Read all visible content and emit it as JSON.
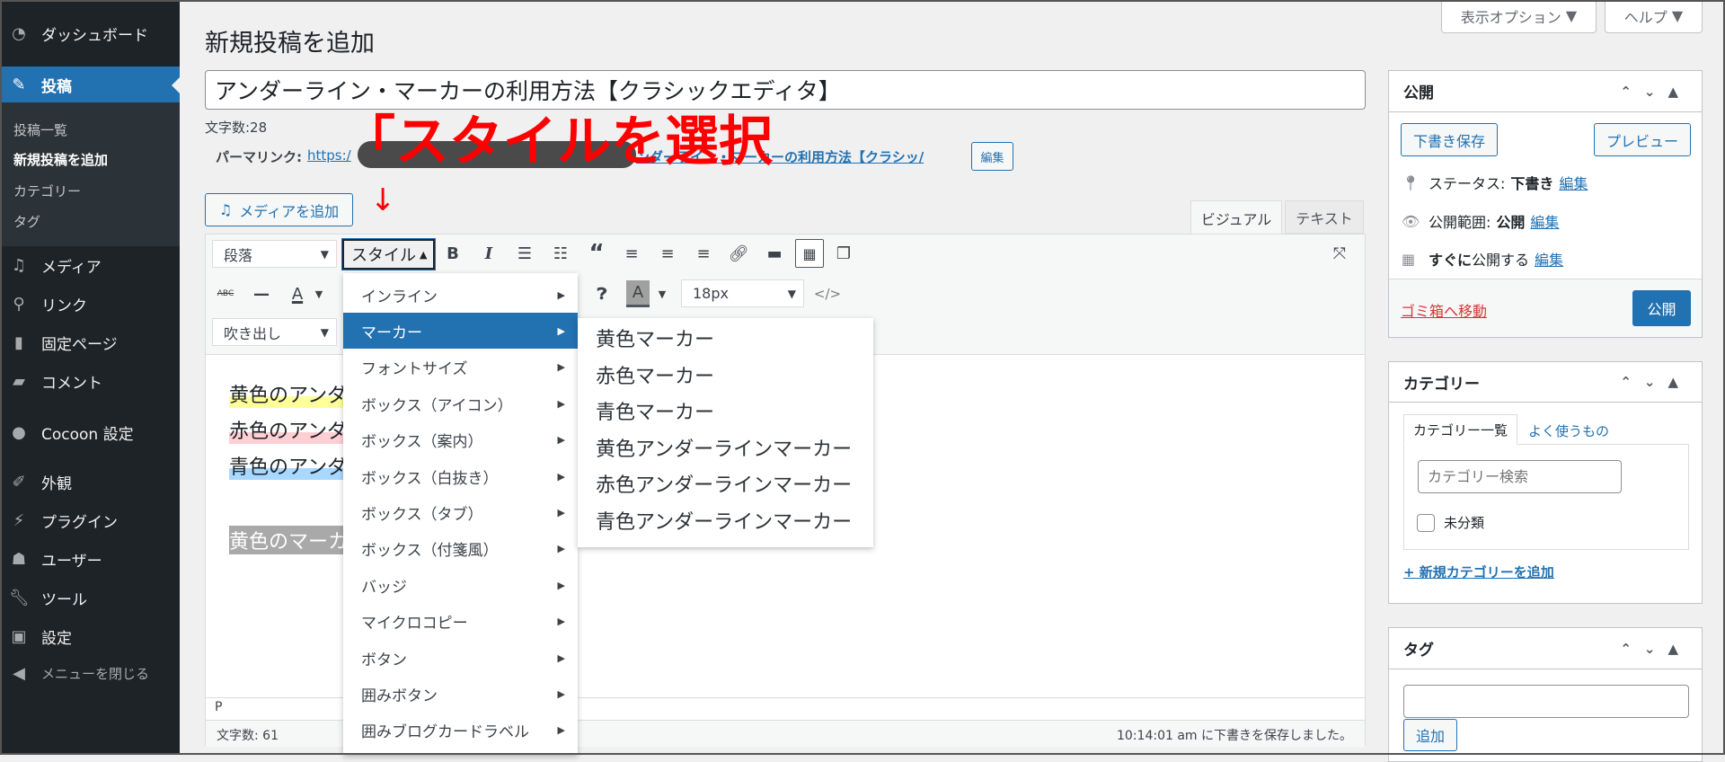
{
  "sidebar": {
    "items": [
      {
        "label": "ダッシュボード",
        "icon": "dashboard-icon"
      },
      {
        "label": "投稿",
        "icon": "pin-icon",
        "active": true
      },
      {
        "label": "メディア",
        "icon": "media-icon"
      },
      {
        "label": "リンク",
        "icon": "link-icon"
      },
      {
        "label": "固定ページ",
        "icon": "page-icon"
      },
      {
        "label": "コメント",
        "icon": "comment-icon"
      },
      {
        "label": "Cocoon 設定",
        "icon": "cocoon-icon"
      },
      {
        "label": "外観",
        "icon": "appearance-icon"
      },
      {
        "label": "プラグイン",
        "icon": "plugin-icon"
      },
      {
        "label": "ユーザー",
        "icon": "user-icon"
      },
      {
        "label": "ツール",
        "icon": "wrench-icon"
      },
      {
        "label": "設定",
        "icon": "settings-icon"
      },
      {
        "label": "メニューを閉じる",
        "icon": "collapse-icon"
      }
    ],
    "submenu": [
      "投稿一覧",
      "新規投稿を追加",
      "カテゴリー",
      "タグ"
    ]
  },
  "header": {
    "screen_options": "表示オプション",
    "help": "ヘルプ",
    "title": "新規投稿を追加"
  },
  "post": {
    "title": "アンダーライン・マーカーの利用方法【クラシックエディタ】",
    "char_count": "文字数:28",
    "permalink_label": "パーマリンク:",
    "permalink_start": "https:/",
    "permalink_end": "ンダーライン・マーカーの利用方法【クラシッ/",
    "permalink_edit": "編集"
  },
  "annotation": {
    "text": "「スタイルを選択",
    "arrow": "↓"
  },
  "editor": {
    "add_media": "メディアを追加",
    "tab_visual": "ビジュアル",
    "tab_text": "テキスト",
    "format_select": "段落",
    "style_button": "スタイル",
    "balloon_select": "吹き出し",
    "font_size": "18px",
    "content": [
      "黄色のアンダ",
      "赤色のアンダ",
      "青色のアンダ",
      "黄色のマーカ"
    ],
    "path": "P",
    "word_count": "文字数: 61",
    "saved": "10:14:01 am に下書きを保存しました。"
  },
  "style_menu": {
    "items": [
      "インライン",
      "マーカー",
      "フォントサイズ",
      "ボックス（アイコン）",
      "ボックス（案内）",
      "ボックス（白抜き）",
      "ボックス（タブ）",
      "ボックス（付箋風）",
      "バッジ",
      "マイクロコピー",
      "ボタン",
      "囲みボタン",
      "囲みブログカードラベル"
    ],
    "active": "マーカー",
    "submenu": [
      "黄色マーカー",
      "赤色マーカー",
      "青色マーカー",
      "黄色アンダーラインマーカー",
      "赤色アンダーラインマーカー",
      "青色アンダーラインマーカー"
    ]
  },
  "publish": {
    "title": "公開",
    "save_draft": "下書き保存",
    "preview": "プレビュー",
    "status_label": "ステータス:",
    "status": "下書き",
    "visibility_label": "公開範囲:",
    "visibility": "公開",
    "schedule_bold": "すぐに",
    "schedule": "公開する",
    "edit": "編集",
    "trash": "ゴミ箱へ移動",
    "publish": "公開"
  },
  "category": {
    "title": "カテゴリー",
    "tab_all": "カテゴリー一覧",
    "tab_popular": "よく使うもの",
    "search_placeholder": "カテゴリー検索",
    "items": [
      "未分類"
    ],
    "add_new": "+ 新規カテゴリーを追加"
  },
  "tags": {
    "title": "タグ",
    "add": "追加"
  },
  "colors": {
    "accent": "#2271b1",
    "sidebar": "#1d2327",
    "annotation": "#ff0000",
    "yellow_marker": "#ffff99",
    "red_marker": "#ffcfd4",
    "blue_marker": "#a8d8ff",
    "selection": "#a9a9a9"
  }
}
